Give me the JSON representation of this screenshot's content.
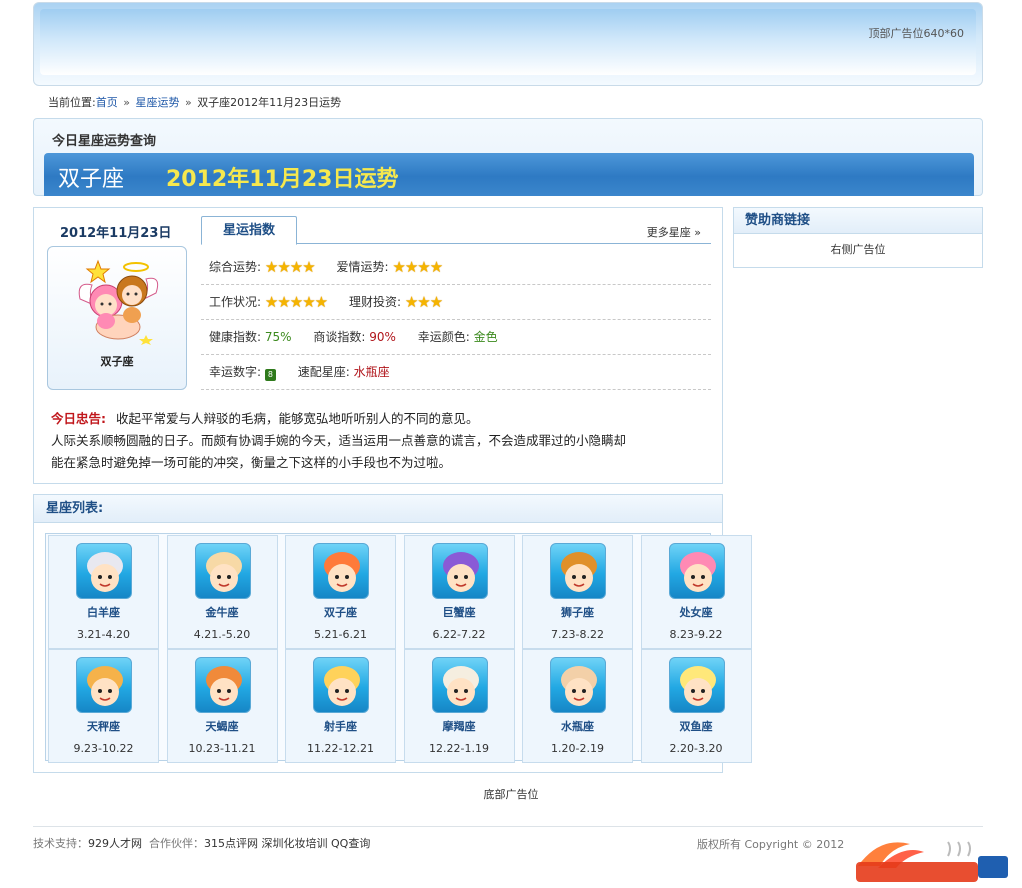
{
  "top_ad": {
    "text": "顶部广告位640*60"
  },
  "breadcrumb": {
    "prefix": "当前位置:",
    "home": "首页",
    "section": "星座运势",
    "current": "双子座2012年11月23日运势",
    "sep": "»"
  },
  "query": {
    "title": "今日星座运势查询",
    "sign": "双子座",
    "date_heading": "2012年11月23日运势"
  },
  "panel": {
    "date": "2012年11月23日",
    "sign_name": "双子座",
    "tab": "星运指数",
    "more": "更多星座 »",
    "overall_label": "综合运势:",
    "overall_stars": 4,
    "love_label": "爱情运势:",
    "love_stars": 4,
    "work_label": "工作状况:",
    "work_stars": 5,
    "finance_label": "理财投资:",
    "finance_stars": 3,
    "health_label": "健康指数:",
    "health_value": "75%",
    "negotiation_label": "商谈指数:",
    "negotiation_value": "90%",
    "color_label": "幸运颜色:",
    "color_value": "金色",
    "number_label": "幸运数字:",
    "number_value": "8",
    "match_label": "速配星座:",
    "match_value": "水瓶座",
    "advice_label": "今日忠告:",
    "advice_line1": "收起平常爱与人辩驳的毛病，能够宽弘地听听别人的不同的意见。",
    "advice_line2": "人际关系顺畅圆融的日子。而颇有协调手婉的今天，适当运用一点善意的谎言，不会造成罪过的小隐瞒却",
    "advice_line3": "能在紧急时避免掉一场可能的冲突，衡量之下这样的小手段也不为过啦。"
  },
  "sponsor": {
    "title": "赞助商链接",
    "ad": "右侧广告位"
  },
  "list": {
    "title": "星座列表:",
    "items": [
      {
        "name": "白羊座",
        "date": "3.21-4.20"
      },
      {
        "name": "金牛座",
        "date": "4.21.-5.20"
      },
      {
        "name": "双子座",
        "date": "5.21-6.21"
      },
      {
        "name": "巨蟹座",
        "date": "6.22-7.22"
      },
      {
        "name": "狮子座",
        "date": "7.23-8.22"
      },
      {
        "name": "处女座",
        "date": "8.23-9.22"
      },
      {
        "name": "天秤座",
        "date": "9.23-10.22"
      },
      {
        "name": "天蝎座",
        "date": "10.23-11.21"
      },
      {
        "name": "射手座",
        "date": "11.22-12.21"
      },
      {
        "name": "摩羯座",
        "date": "12.22-1.19"
      },
      {
        "name": "水瓶座",
        "date": "1.20-2.19"
      },
      {
        "name": "双鱼座",
        "date": "2.20-3.20"
      }
    ]
  },
  "bottom_ad": "底部广告位",
  "footer": {
    "support_label": "技术支持：",
    "support_link": "929人才网",
    "partner_label": "合作伙伴：",
    "partner_links": [
      "315点评网",
      "深圳化妆培训",
      "QQ查询"
    ],
    "copyright": "版权所有 Copyright © 2012"
  },
  "colors": {
    "brand_blue": "#2e7ac3",
    "heading_yellow": "#f6e84e",
    "advice_red": "#c0161b",
    "star_gold": "#f5b400"
  }
}
